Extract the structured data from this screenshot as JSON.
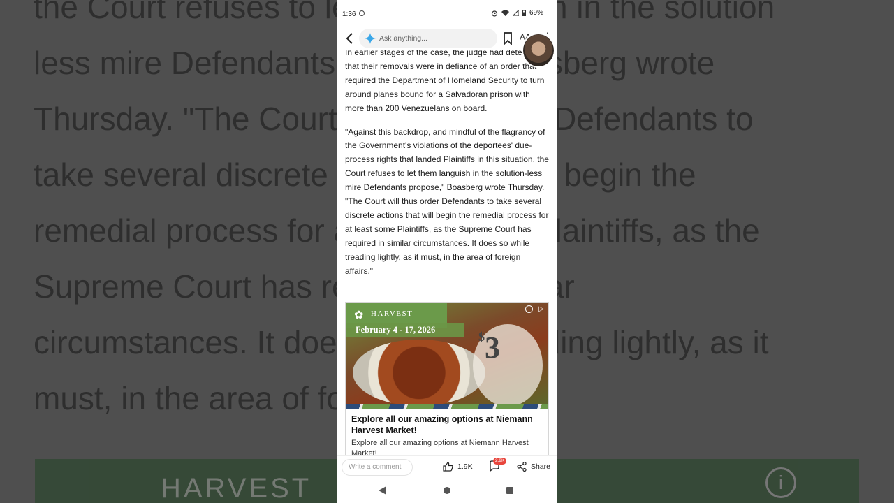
{
  "background": {
    "lines": [
      "the Court refuses to let them languish in the solution",
      "less mire Defendants propose,\" Boasberg wrote",
      "Thursday. \"The Court will thus order Defendants to",
      "take several discrete actions that will begin the",
      "remedial process for at least some Plaintiffs, as the",
      "Supreme Court has required in similar",
      "circumstances. It does so while treading lightly, as it",
      "must, in the area of foreign affairs.\""
    ],
    "ad_label": "HARVEST",
    "info_glyph": "i"
  },
  "status_bar": {
    "time": "1:36",
    "battery": "69%"
  },
  "top_bar": {
    "search_placeholder": "Ask anything...",
    "font_size_label": "AA",
    "more_glyph": "⋮"
  },
  "article": {
    "paragraphs": [
      "In earlier stages of the case, the judge had determined that their removals were in defiance of an order that required the Department of Homeland Security to turn around planes bound for a Salvadoran prison with more than 200 Venezuelans on board.",
      "\"Against this backdrop, and mindful of the flagrancy of the Government's violations of the deportees' due-process rights that landed Plaintiffs in this situation, the Court refuses to let them languish in the solution-less mire Defendants propose,\" Boasberg wrote Thursday. \"The Court will thus order Defendants to take several discrete actions that will begin the remedial process for at least some Plaintiffs, as the Supreme Court has required in similar circumstances. It does so while treading lightly, as it must, in the area of foreign affairs.\""
    ]
  },
  "ad": {
    "brand": "HARVEST",
    "brand_small": "Niemann",
    "dates": "February 4 - 17, 2026",
    "price_symbol": "$",
    "price": "3",
    "title": "Explore all our amazing options at Niemann Harvest Market!",
    "description": "Explore all our amazing options at Niemann Harvest Market!"
  },
  "bottom_bar": {
    "comment_placeholder": "Write a comment",
    "likes": "1.9K",
    "comments_badge": "2.9K",
    "share_label": "Share"
  },
  "colors": {
    "accent_badge": "#e8453c",
    "ad_green": "#6b9a4a"
  }
}
